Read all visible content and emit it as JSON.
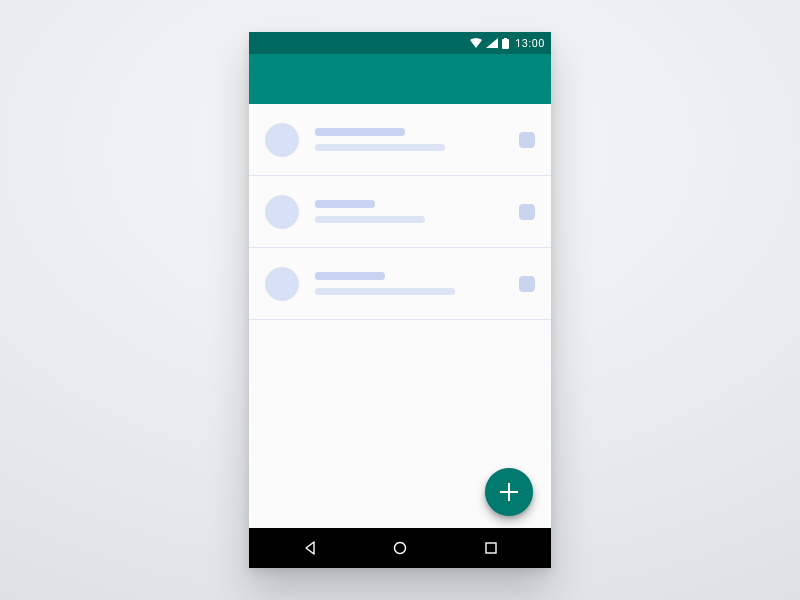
{
  "statusbar": {
    "time": "13:00",
    "icons": [
      "wifi",
      "signal",
      "battery"
    ]
  },
  "appbar": {
    "title": ""
  },
  "list": {
    "items": [
      {
        "title_width": 90,
        "subtitle_width": 130
      },
      {
        "title_width": 60,
        "subtitle_width": 110
      },
      {
        "title_width": 70,
        "subtitle_width": 140
      }
    ]
  },
  "fab": {
    "kind": "add",
    "glyph": "+"
  },
  "navbar": {
    "buttons": [
      "back",
      "home",
      "recents"
    ]
  },
  "colors": {
    "statusbar": "#00695f",
    "appbar": "#00897b",
    "fab": "#00796f",
    "skeleton": "#c8d4f0",
    "skeleton_light": "#dbe3f5",
    "avatar": "#d7e0f4"
  }
}
